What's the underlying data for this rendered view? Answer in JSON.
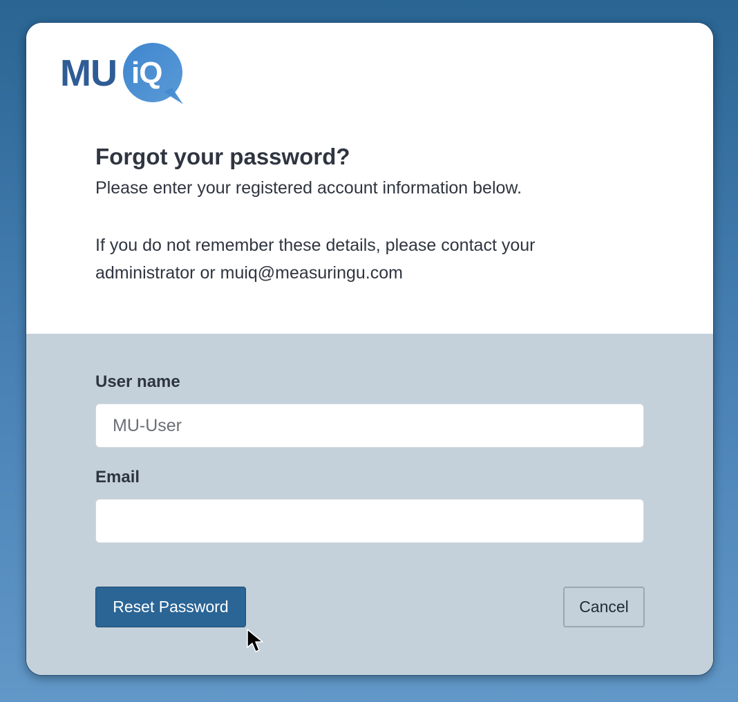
{
  "logo": {
    "brand_left": "MU",
    "brand_right": "iQ"
  },
  "dialog": {
    "title": "Forgot your password?",
    "subtitle": "Please enter your registered account information below.",
    "help_text": "If you do not remember these details, please contact your administrator or muiq@measuringu.com"
  },
  "form": {
    "username_label": "User name",
    "username_placeholder": "MU-User",
    "username_value": "",
    "email_label": "Email",
    "email_placeholder": "",
    "email_value": "",
    "reset_button_label": "Reset Password",
    "cancel_button_label": "Cancel"
  },
  "colors": {
    "background_top": "#2a6593",
    "background_bottom": "#6198c8",
    "form_panel": "#c4d1da",
    "primary_button": "#2a6595",
    "brand_dark": "#2f5c95",
    "brand_light": "#4b8fd0"
  },
  "icons": {
    "cursor": "arrow-pointer-icon"
  }
}
